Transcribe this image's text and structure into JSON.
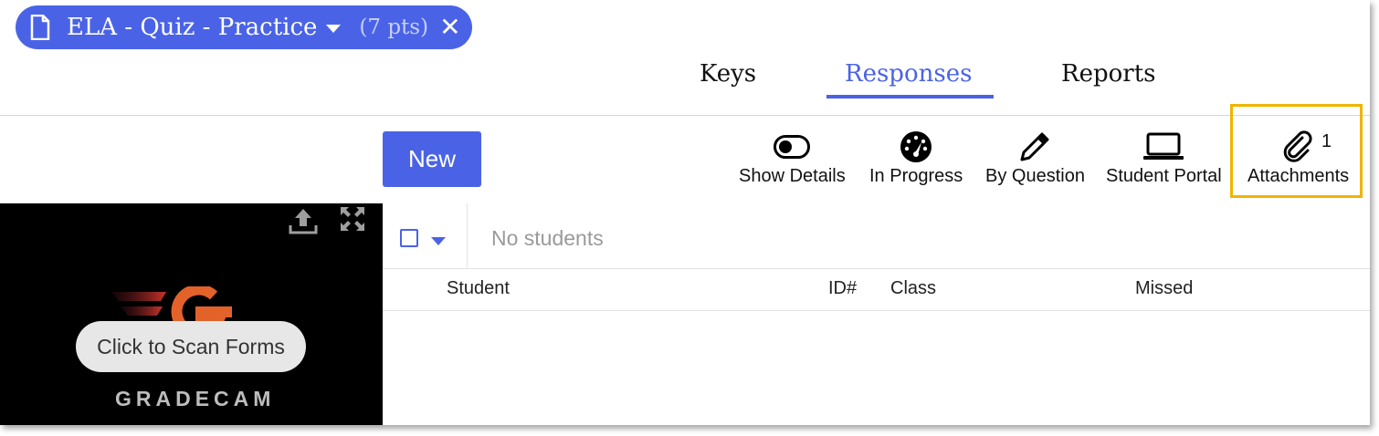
{
  "header": {
    "quiz_title": "ELA - Quiz - Practice",
    "points": "(7 pts)",
    "close_glyph": "✕"
  },
  "tabs": [
    {
      "label": "Keys",
      "active": false
    },
    {
      "label": "Responses",
      "active": true
    },
    {
      "label": "Reports",
      "active": false
    }
  ],
  "toolbar": {
    "new_label": "New",
    "tools": [
      {
        "label": "Show Details",
        "icon": "toggle-icon"
      },
      {
        "label": "In Progress",
        "icon": "gauge-icon"
      },
      {
        "label": "By Question",
        "icon": "pencil-icon"
      },
      {
        "label": "Student Portal",
        "icon": "laptop-icon"
      },
      {
        "label": "Attachments",
        "icon": "paperclip-icon"
      }
    ],
    "attachments_count": "1"
  },
  "camera": {
    "scan_label": "Click to Scan Forms",
    "brand": "GRADECAM"
  },
  "table": {
    "empty_text": "No students",
    "columns": [
      "Student",
      "ID#",
      "Class",
      "Missed"
    ]
  },
  "colors": {
    "accent": "#4a63e6",
    "highlight": "#f0b400"
  }
}
